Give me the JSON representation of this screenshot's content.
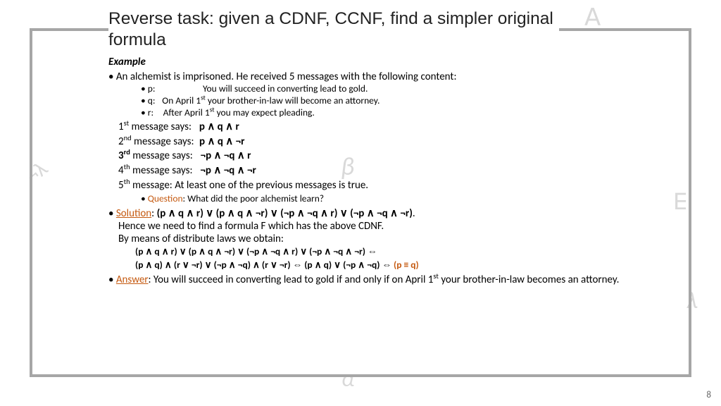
{
  "title": "Reverse task: given a CDNF, CCNF, find a simpler original formula",
  "exampleLabel": "Example",
  "intro": "An alchemist is imprisoned. He received 5 messages with the following content:",
  "defs": {
    "p": "p:         You will succeed in converting lead to gold.",
    "q_pre": "q:  On April 1",
    "q_post": " your brother-in-law will become an attorney.",
    "r_pre": "r: After April 1",
    "r_post": " you may expect pleading."
  },
  "msgs": {
    "m1_lbl": " message says:  ",
    "m1_f": "p ∧ q ∧ r",
    "m2_lbl": " message says: ",
    "m2_f": "p ∧ q ∧ ¬r",
    "m3_lbl": " message says:  ",
    "m3_f": "¬p ∧ ¬q ∧ r",
    "m4_lbl": " message says:  ",
    "m4_f": "¬p ∧ ¬q ∧ ¬r",
    "m5": " message: At least one of the previous messages is true."
  },
  "questionLabel": "Question",
  "questionText": ": What did the poor alchemist learn?",
  "solutionLabel": "Solution",
  "solution": {
    "line1a": ": ",
    "line1b": "(p ∧ q ∧ r) ∨ (p ∧ q ∧ ¬r) ∨ (¬p ∧ ¬q ∧ r) ∨ (¬p ∧ ¬q ∧ ¬r)",
    "line1c": ".",
    "line2": "Hence we need to find a formula F which has the above CDNF.",
    "line3": "By means of distribute laws we obtain:",
    "f1": "(p ∧ q ∧ r) ∨ (p ∧ q ∧ ¬r) ∨ (¬p ∧ ¬q ∧ r) ∨ (¬p ∧ ¬q ∧ ¬r) ⇔",
    "f2a": "(p ∧ q) ∧ (r ∨ ¬r) ∨ (¬p ∧ ¬q) ∧ (r ∨ ¬r) ⇔ (p ∧ q) ∨ (¬p ∧ ¬q) ⇔ ",
    "f2b": "(p ≡ q)"
  },
  "answerLabel": "Answer",
  "answer_pre": ": You will succeed in converting lead to gold if and only if on April 1",
  "answer_post": " your brother-in-law becomes an attorney.",
  "pageNumber": "8",
  "greek": {
    "forall": "∀",
    "beta": "β",
    "neglam": "¬λ",
    "exists": "∃",
    "lambda": "λ",
    "alpha": "α"
  },
  "sup": {
    "st": "st",
    "nd": "nd",
    "rd": "rd",
    "th": "th"
  }
}
